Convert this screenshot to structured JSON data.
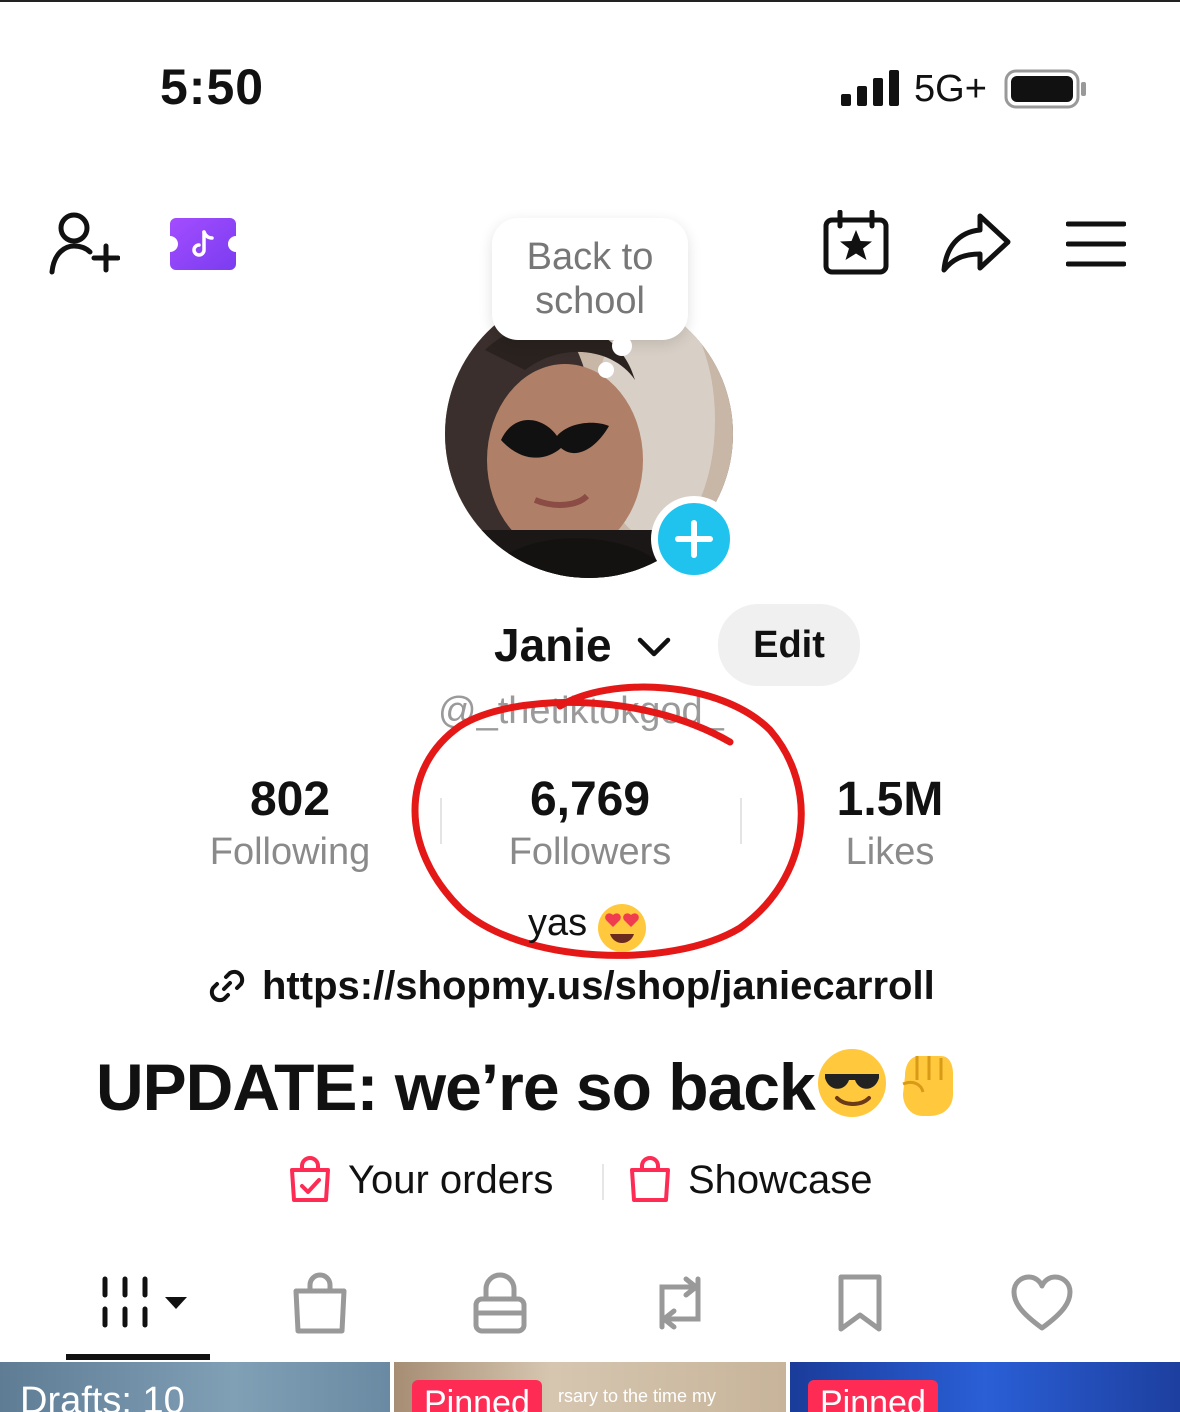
{
  "status_bar": {
    "time": "5:50",
    "network": "5G+",
    "icons": [
      "signal-icon",
      "battery-icon"
    ]
  },
  "header": {
    "icons": [
      "add-user-icon",
      "tiktok-pass-icon",
      "calendar-star-icon",
      "share-icon",
      "menu-icon"
    ]
  },
  "note_bubble": {
    "text": "Back to school"
  },
  "profile": {
    "name": "Janie",
    "edit_label": "Edit",
    "handle": "@_thetiktokgod_"
  },
  "stats": {
    "following": {
      "value": "802",
      "label": "Following"
    },
    "followers": {
      "value": "6,769",
      "label": "Followers"
    },
    "likes": {
      "value": "1.5M",
      "label": "Likes"
    }
  },
  "annotation": {
    "text": "yas",
    "color": "#e51818"
  },
  "bio": {
    "link": "https://shopmy.us/shop/janiecarroll",
    "headline": "UPDATE: we’re so back"
  },
  "shop": {
    "orders_label": "Your orders",
    "showcase_label": "Showcase",
    "accent": "#fe2c55"
  },
  "tabs": [
    {
      "name": "videos",
      "icon": "grid-icon",
      "active": true
    },
    {
      "name": "shop",
      "icon": "bag-icon"
    },
    {
      "name": "private",
      "icon": "lock-icon"
    },
    {
      "name": "reposts",
      "icon": "repost-icon"
    },
    {
      "name": "saved",
      "icon": "bookmark-icon"
    },
    {
      "name": "liked",
      "icon": "heart-icon"
    }
  ],
  "thumbnails": {
    "drafts": "Drafts: 10",
    "pinned_label": "Pinned",
    "caption": "rsary to the time my"
  }
}
